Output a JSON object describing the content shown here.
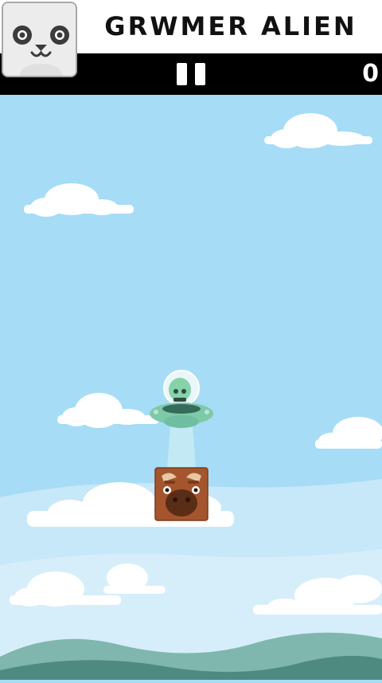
{
  "header": {
    "title": "GRWMER ALIEN",
    "score": "0",
    "avatar_icon": "panda-face-icon",
    "pause_icon": "pause-icon"
  },
  "scene": {
    "characters": [
      "alien-ufo",
      "cow-block"
    ],
    "colors": {
      "sky": "#a6dcf6",
      "hills_back": "#7fb7ae",
      "hills_front": "#4f8a80",
      "ufo": "#7ec9a8",
      "alien": "#86d3a9",
      "cow": "#a5552e"
    }
  }
}
